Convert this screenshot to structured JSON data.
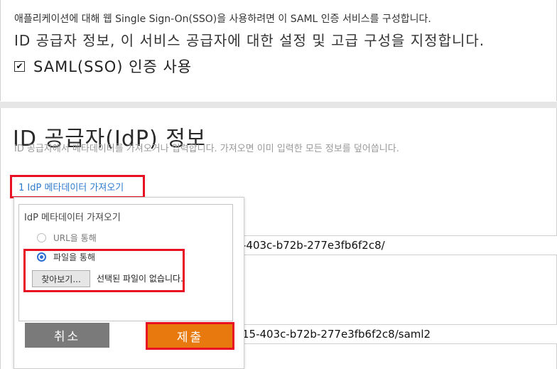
{
  "intro": {
    "description_small": "애플리케이션에 대해 웹 Single Sign-On(SSO)을 사용하려면 이 SAML 인증 서비스를 구성합니다.",
    "description_large": "ID 공급자 정보, 이 서비스 공급자에 대한 설정 및 고급 구성을 지정합니다.",
    "checkbox_label": "SAML(SSO) 인증 사용",
    "checkbox_checked": true
  },
  "idp_section": {
    "heading": "ID 공급자(IdP) 정보",
    "description": "ID 공급자에서 메타데이터를 가져오거나 입력합니다. 가져오면 이미 입력한 모든 정보를 덮어씁니다.",
    "import_link": "1 IdP 메타데이터 가져오기",
    "field1_value": "-403c-b72b-277e3fb6f2c8/",
    "field2_value": "15-403c-b72b-277e3fb6f2c8/saml2"
  },
  "import_popup": {
    "title": "IdP 메타데이터 가져오기",
    "option_url": "URL을 통해",
    "option_file": "파일을 통해",
    "selected_option": "file",
    "browse_label": "찾아보기...",
    "no_file_text": "선택된 파일이 없습니다.",
    "cancel_label": "취소",
    "submit_label": "제출"
  },
  "colors": {
    "highlight": "#e81123",
    "link": "#2e7bcf",
    "submit": "#e8790f",
    "cancel": "#7a7a7a"
  }
}
